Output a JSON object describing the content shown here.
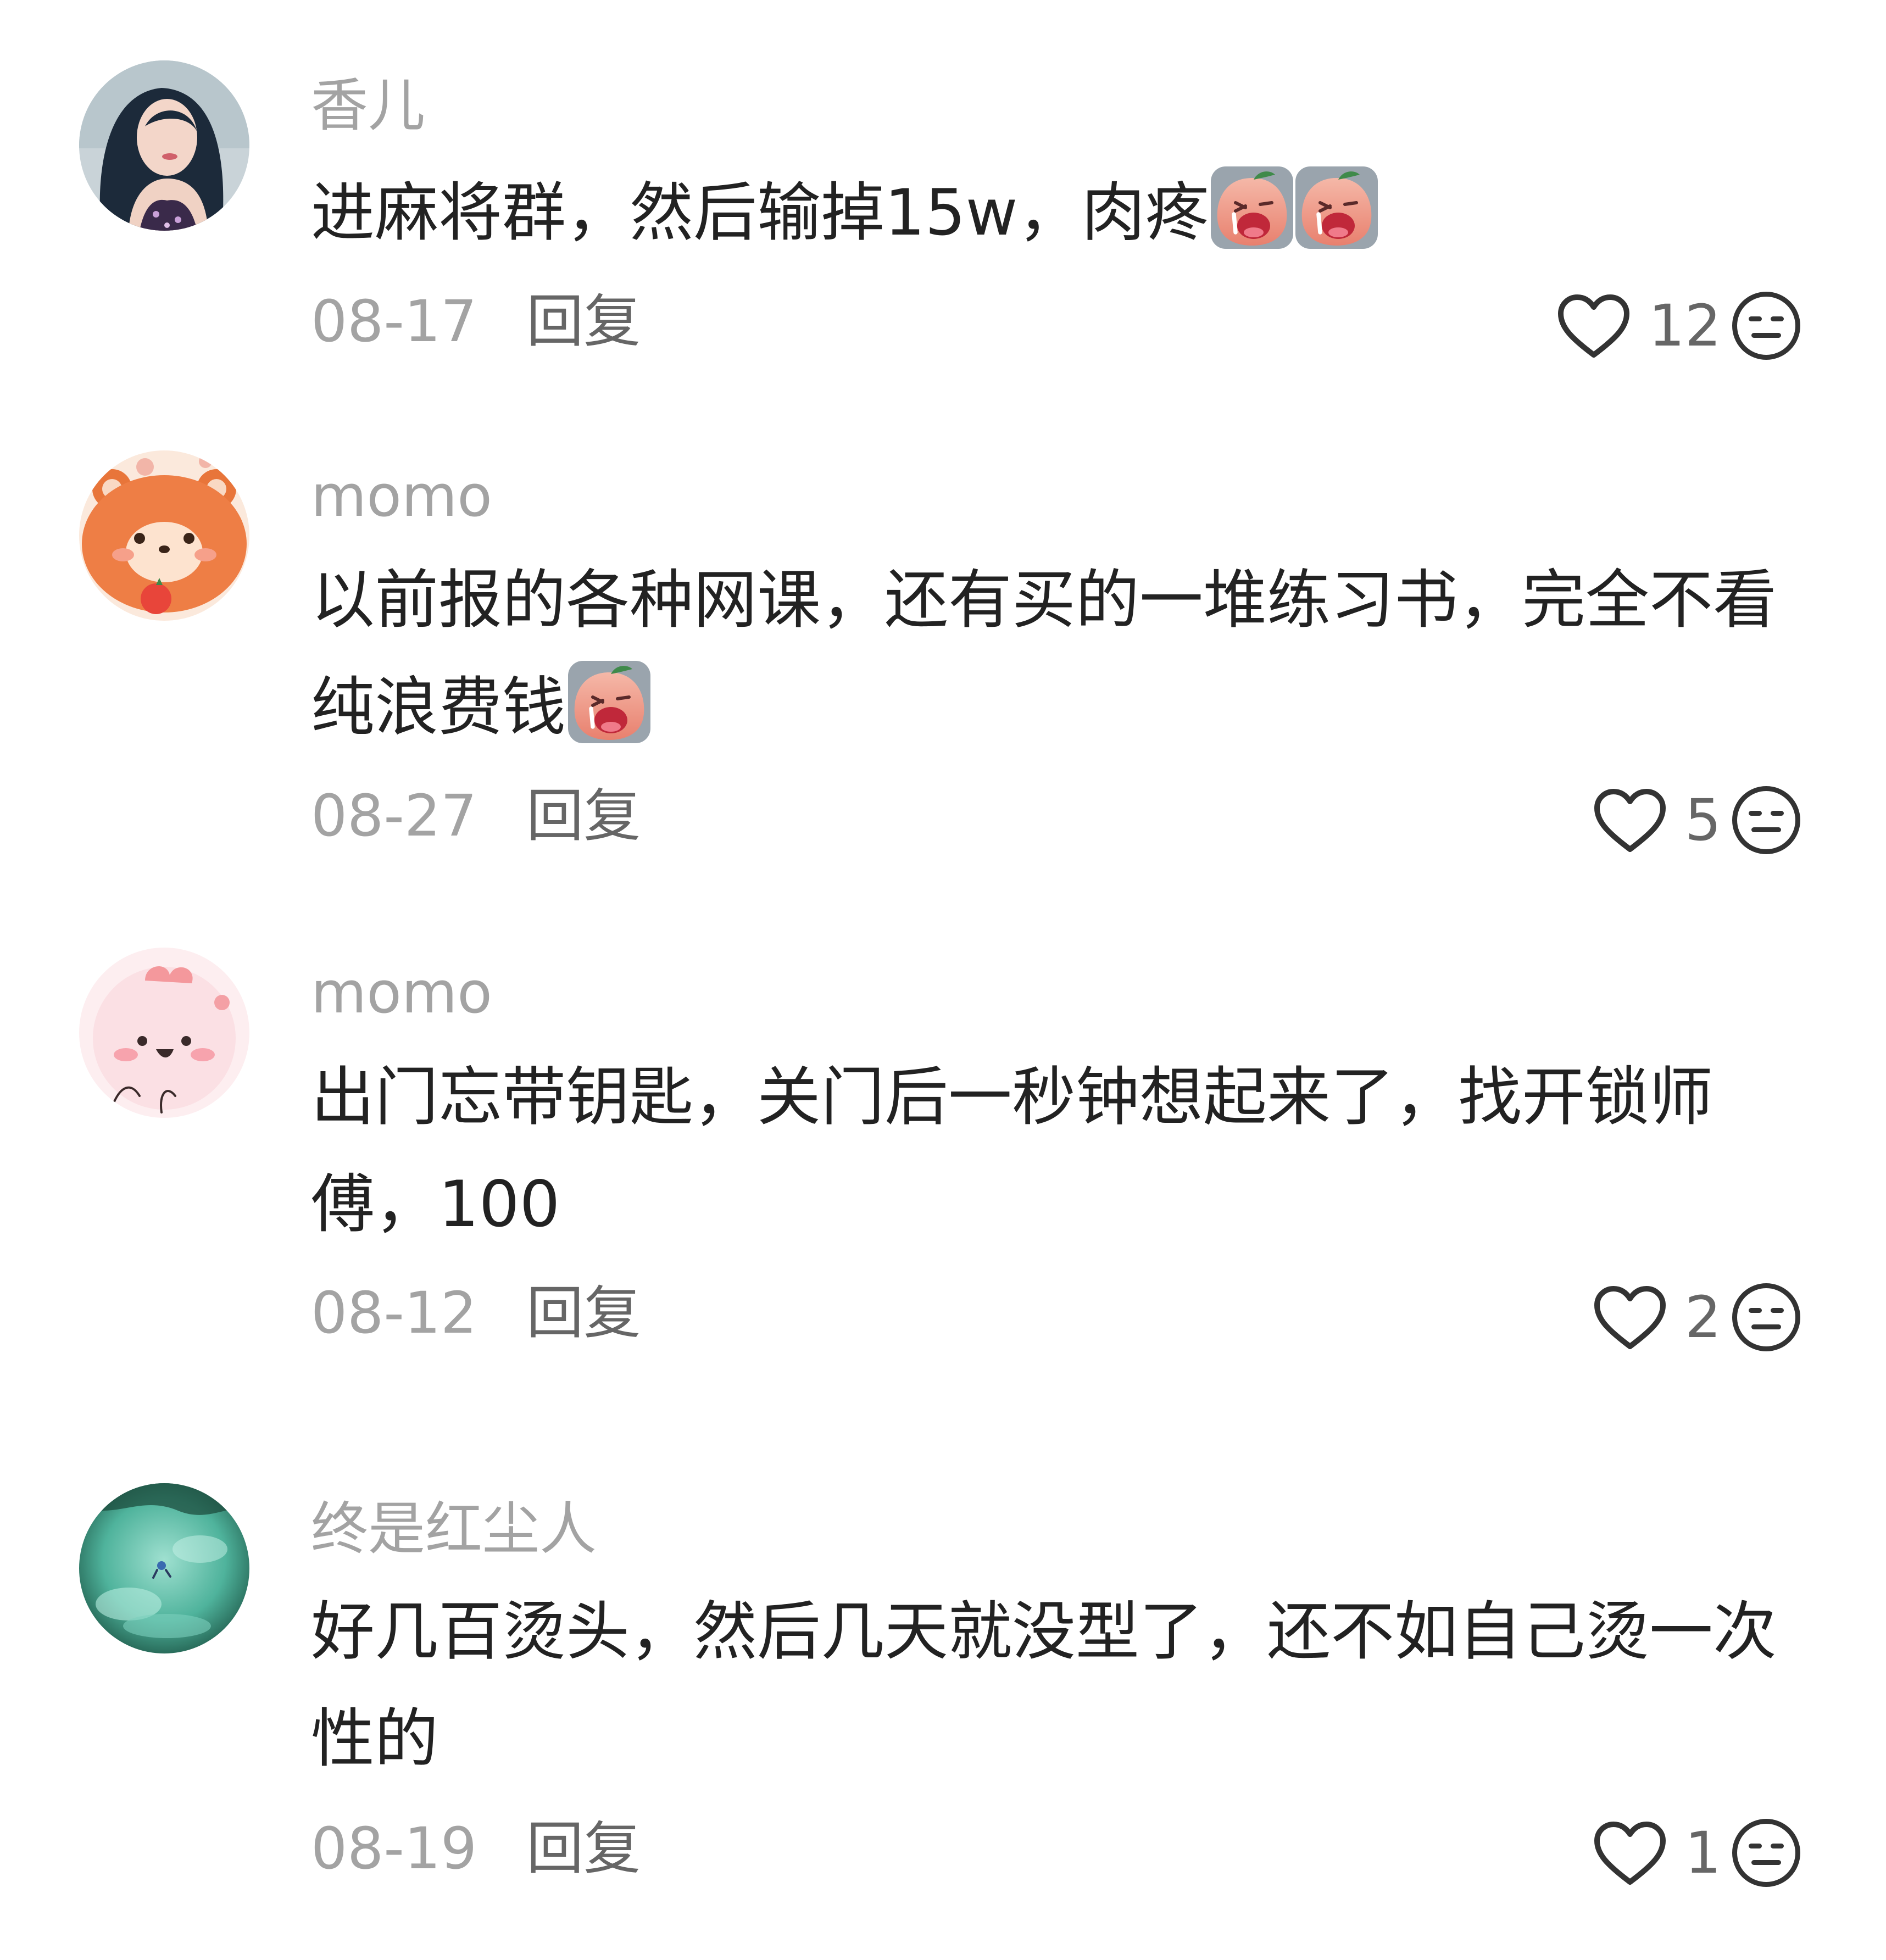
{
  "comments": [
    {
      "username": "香儿",
      "text": "进麻将群，然后输掉15w，肉疼",
      "emoji_count": 2,
      "emoji": "crying-peach-emoji",
      "date": "08-17",
      "reply_label": "回复",
      "likes": "12",
      "avatar": "woman-photo-avatar"
    },
    {
      "username": "momo",
      "text": "以前报的各种网课，还有买的一堆练习书，完全不看纯浪费钱",
      "emoji_count": 1,
      "emoji": "crying-peach-emoji",
      "date": "08-27",
      "reply_label": "回复",
      "likes": "5",
      "avatar": "red-panda-cartoon-avatar"
    },
    {
      "username": "momo",
      "text": "出门忘带钥匙，关门后一秒钟想起来了，找开锁师傅，100",
      "emoji_count": 0,
      "date": "08-12",
      "reply_label": "回复",
      "likes": "2",
      "avatar": "pink-blob-cartoon-avatar"
    },
    {
      "username": "终是红尘人",
      "text": "好几百烫头，然后几天就没型了，还不如自己烫一次性的",
      "emoji_count": 0,
      "date": "08-19",
      "reply_label": "回复",
      "likes": "1",
      "avatar": "water-swimmer-photo-avatar"
    }
  ],
  "icons": {
    "like": "heart-outline-icon",
    "reaction": "neutral-face-icon"
  },
  "colors": {
    "text": "#222222",
    "muted": "#a3a3a3",
    "secondary": "#666666",
    "icon": "#333333"
  }
}
